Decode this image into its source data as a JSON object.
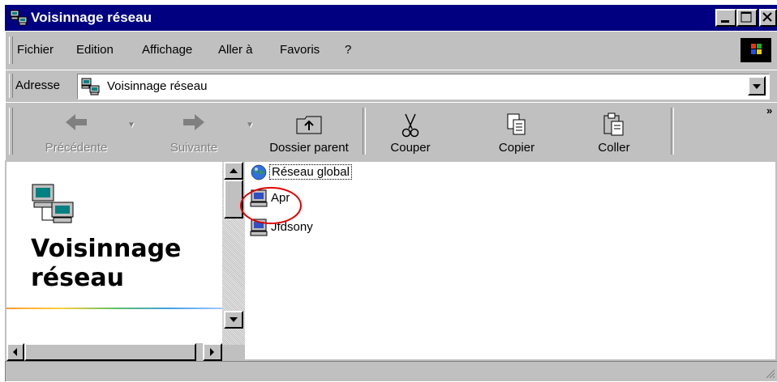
{
  "window": {
    "title": "Voisinnage réseau",
    "controls": [
      "minimize",
      "maximize",
      "close"
    ]
  },
  "menu": {
    "items": [
      "Fichier",
      "Edition",
      "Affichage",
      "Aller à",
      "Favoris",
      "?"
    ]
  },
  "address": {
    "label": "Adresse",
    "value": "Voisinnage réseau"
  },
  "toolbar": {
    "back": "Précédente",
    "forward": "Suivante",
    "parent": "Dossier parent",
    "cut": "Couper",
    "copy": "Copier",
    "paste": "Coller",
    "more": "»"
  },
  "left_panel": {
    "heading_line1": "Voisinnage",
    "heading_line2": "réseau"
  },
  "files": [
    {
      "name": "Réseau global",
      "icon": "globe-icon",
      "selected": true
    },
    {
      "name": "Apr",
      "icon": "computer-icon",
      "selected": false
    },
    {
      "name": "Jfdsony",
      "icon": "computer-icon",
      "selected": false
    }
  ],
  "colors": {
    "titlebar": "#000080",
    "window": "#c0c0c0",
    "annotation": "#e00000"
  }
}
